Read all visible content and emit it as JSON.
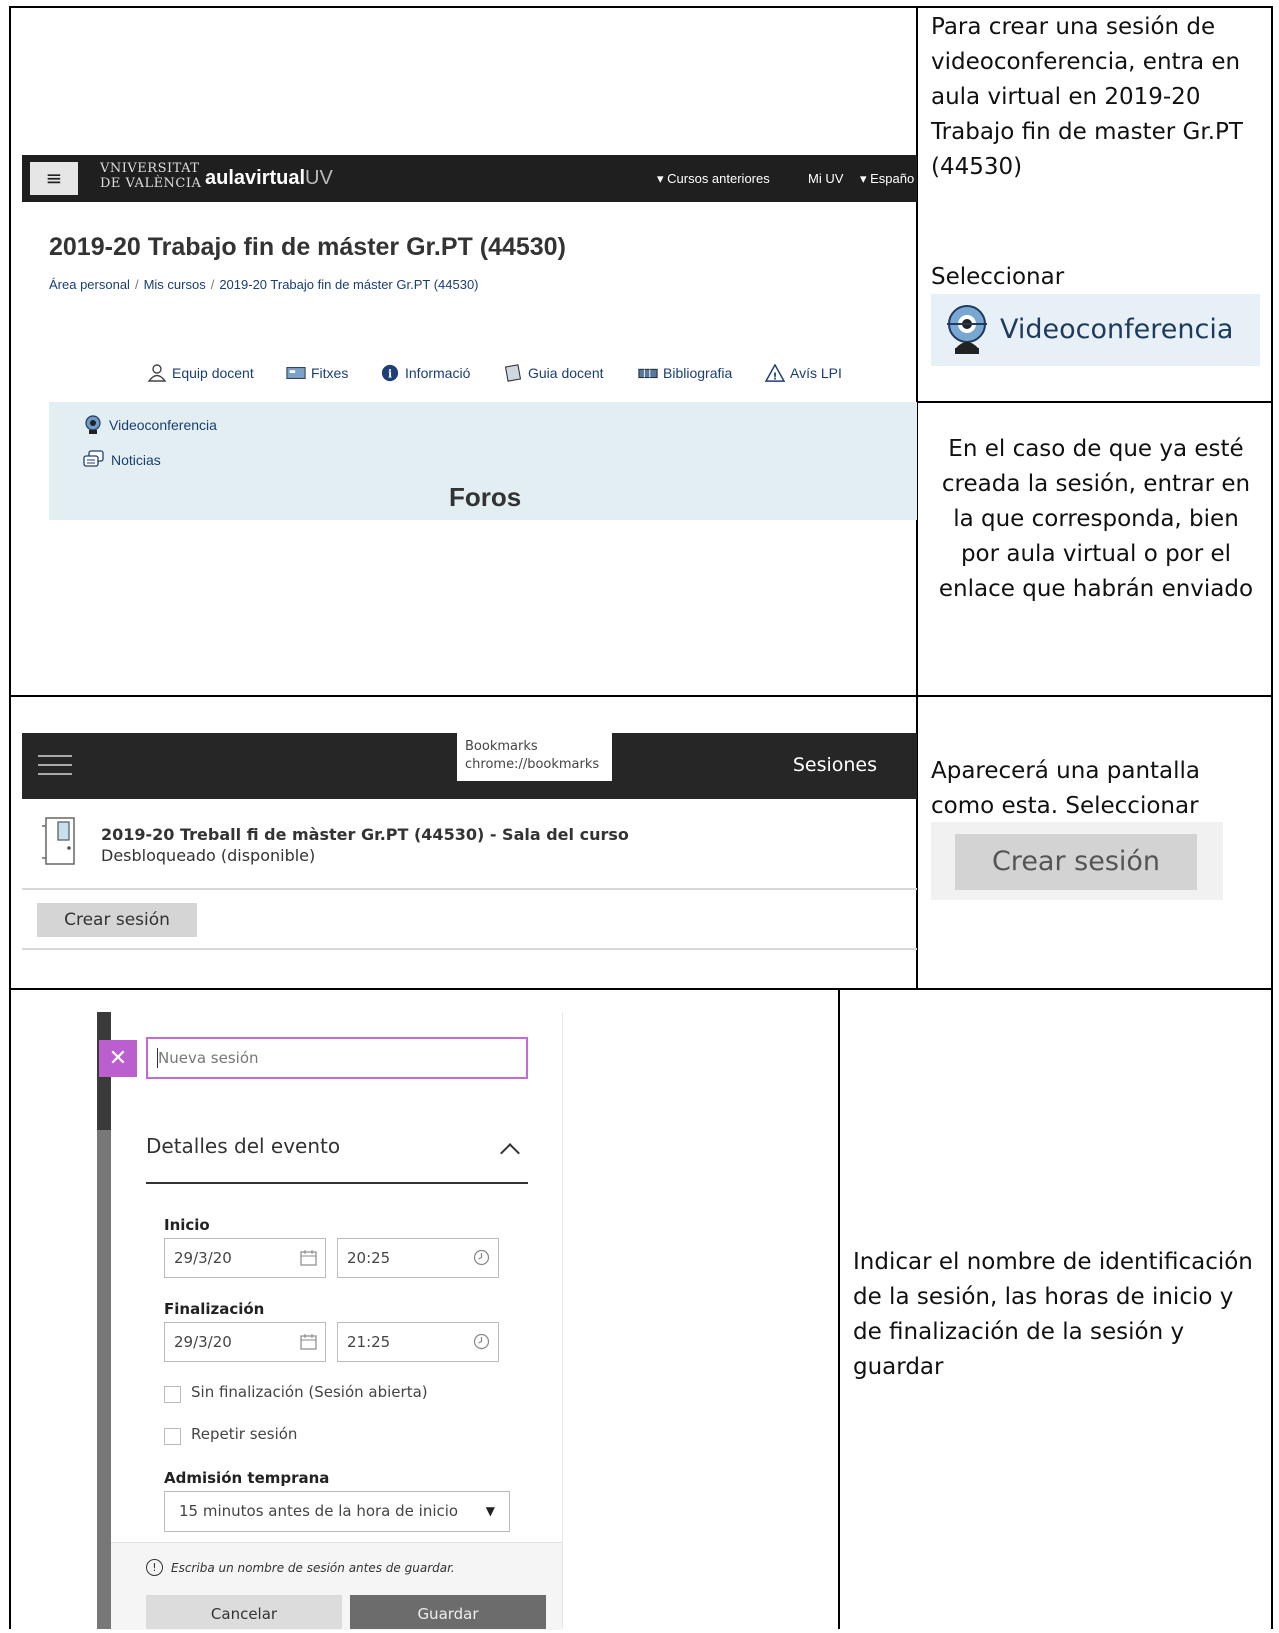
{
  "row1": {
    "uv_header": {
      "menu_icon": "hamburger-icon",
      "university_line1": "VNIVERSITAT",
      "university_line2": "DE VALÈNCIA",
      "aula_brand": "aulavirtual",
      "aula_suffix": "UV",
      "nav_cursos": "▾ Cursos anteriores",
      "nav_miuv": "Mi UV",
      "nav_lang": "▾ Españo"
    },
    "course_title": "2019-20 Trabajo fin de máster Gr.PT (44530)",
    "breadcrumb": [
      "Área personal",
      "Mis cursos",
      "2019-20 Trabajo fin de máster Gr.PT (44530)"
    ],
    "course_blocks": [
      "Equip docent",
      "Fitxes",
      "Informació",
      "Guia docent",
      "Bibliografia",
      "Avís LPI"
    ],
    "activities": [
      "Videoconferencia",
      "Noticias"
    ],
    "section_title": "Foros",
    "instruction": "Para crear una sesión de videoconferencia, entra en aula virtual en 2019-20 Trabajo fin de master Gr.PT (44530)",
    "select_label": "Seleccionar",
    "videoconf_button": "Videoconferencia",
    "note": "En el caso de que ya esté creada la sesión, entrar en la que corresponda, bien por aula virtual o por el enlace que habrán enviado"
  },
  "row2": {
    "tooltip_title": "Bookmarks",
    "tooltip_url": "chrome://bookmarks",
    "header_title": "Sesiones",
    "room_title": "2019-20 Treball fi de màster Gr.PT (44530) - Sala del curso",
    "room_status": "Desbloqueado (disponible)",
    "create_button": "Crear sesión",
    "instruction": "Aparecerá una pantalla como esta. Seleccionar",
    "create_button_big": "Crear sesión"
  },
  "row3": {
    "name_placeholder": "Nueva sesión",
    "details_title": "Detalles del evento",
    "start_label": "Inicio",
    "start_date": "29/3/20",
    "start_time": "20:25",
    "end_label": "Finalización",
    "end_date": "29/3/20",
    "end_time": "21:25",
    "no_end_label": "Sin finalización (Sesión abierta)",
    "repeat_label": "Repetir sesión",
    "early_label": "Admisión temprana",
    "early_value": "15 minutos antes de la hora de inicio",
    "warning": "Escriba un nombre de sesión antes de guardar.",
    "cancel_button": "Cancelar",
    "save_button": "Guardar",
    "instruction": "Indicar el nombre de identificación de la sesión, las horas de inicio y de finalización de la sesión y guardar"
  },
  "colors": {
    "dark_bar": "#1f1f1f",
    "section_bg": "#e3eef2",
    "link": "#1a3e73",
    "accent_purple": "#bb5fce"
  }
}
